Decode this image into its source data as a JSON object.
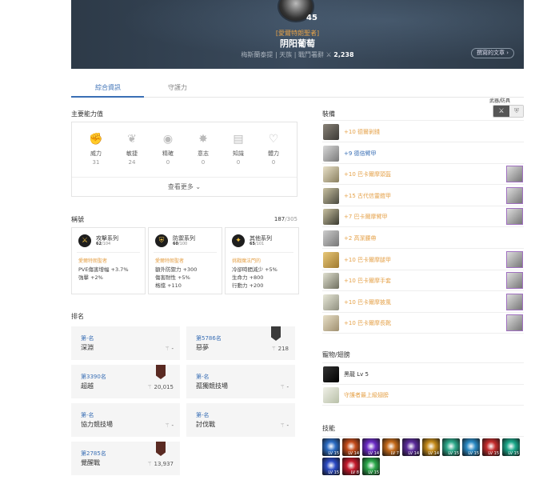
{
  "profile": {
    "level": "45",
    "guild_tag": "[愛爾特朗聖者]",
    "name": "阴阳葡萄",
    "server": "梅斯蘭泰提",
    "race": "天族",
    "score_label": "戰鬥署辭",
    "score": "2,238",
    "posts_button": "撰寫的文章 ›"
  },
  "tabs": [
    {
      "label": "綜合資訊"
    },
    {
      "label": "守護力"
    }
  ],
  "stats": {
    "heading": "主要能力值",
    "items": [
      {
        "label": "威力",
        "value": "31",
        "icon": "fist-icon"
      },
      {
        "label": "敏捷",
        "value": "24",
        "icon": "wing-icon"
      },
      {
        "label": "精確",
        "value": "0",
        "icon": "eye-icon"
      },
      {
        "label": "意志",
        "value": "0",
        "icon": "burst-icon"
      },
      {
        "label": "知識",
        "value": "0",
        "icon": "book-icon"
      },
      {
        "label": "體力",
        "value": "0",
        "icon": "heart-icon"
      }
    ],
    "more_label": "查看更多 ⌄"
  },
  "titles": {
    "heading": "稱號",
    "count": "187",
    "total": "/305",
    "cards": [
      {
        "name": "攻擊系列",
        "count": "62",
        "total": "/104",
        "desc": "愛爾特朗聖者",
        "lines": [
          "PVE傷害增幅 +3.7%",
          "強擊 +2%"
        ]
      },
      {
        "name": "防禦系列",
        "count": "60",
        "total": "/100",
        "desc": "愛爾特朗聖者",
        "lines": [
          "額外防禦力 +300",
          "傷害耐性 +5%",
          "格擋 +110"
        ]
      },
      {
        "name": "其他系列",
        "count": "65",
        "total": "/101",
        "desc": "挑戰魔法門的",
        "lines": [
          "冷卻時間減少 +5%",
          "生命力 +800",
          "行動力 +200"
        ]
      }
    ]
  },
  "rankings": {
    "heading": "排名",
    "items": [
      {
        "rank": "第-名",
        "name": "深淵",
        "score": "-"
      },
      {
        "rank": "第5786名",
        "name": "惡夢",
        "score": "218"
      },
      {
        "rank": "第3390名",
        "name": "超越",
        "score": "20,015"
      },
      {
        "rank": "第-名",
        "name": "孤獨競技場",
        "score": "-"
      },
      {
        "rank": "第-名",
        "name": "協力競技場",
        "score": "-"
      },
      {
        "rank": "第-名",
        "name": "討伐戰",
        "score": "-"
      },
      {
        "rank": "第2785名",
        "name": "覺醒戰",
        "score": "13,937"
      }
    ]
  },
  "equipment": {
    "heading": "裝備",
    "toggle_label": "武器/防具",
    "toggle_icons": [
      "sword-icon",
      "shield-icon"
    ],
    "items": [
      {
        "name": "+10 德爾剝錢",
        "color": "#e5a24a"
      },
      {
        "name": "+9 德倍臂甲",
        "color": "#3a6fb5"
      },
      {
        "name": "+10 巴卡爾摩頭盔",
        "color": "#e5a24a"
      },
      {
        "name": "+15 古代信靈鎧甲",
        "color": "#e5a24a"
      },
      {
        "name": "+7 巴卡爾摩臂甲",
        "color": "#e5a24a"
      },
      {
        "name": "+2 高潔腰帶",
        "color": "#e5a24a"
      },
      {
        "name": "+10 巴卡爾摩腿甲",
        "color": "#e5a24a"
      },
      {
        "name": "+10 巴卡爾摩手套",
        "color": "#e5a24a"
      },
      {
        "name": "+10 巴卡爾摩披風",
        "color": "#e5a24a"
      },
      {
        "name": "+10 巴卡爾摩長靴",
        "color": "#e5a24a"
      }
    ]
  },
  "pets": {
    "heading": "寵物/翅膀",
    "items": [
      {
        "name": "黑龍 Lv 5",
        "color": "#333333"
      },
      {
        "name": "守護者最上級翅膀",
        "color": "#e5a24a"
      }
    ]
  },
  "skills": {
    "heading": "技能",
    "items": [
      {
        "level": "LV 15"
      },
      {
        "level": "LV 14"
      },
      {
        "level": "LV 14"
      },
      {
        "level": "LV 7"
      },
      {
        "level": "LV 14"
      },
      {
        "level": "LV 14"
      },
      {
        "level": "LV 15"
      },
      {
        "level": "LV 15"
      },
      {
        "level": "LV 15"
      },
      {
        "level": "LV 15"
      },
      {
        "level": "LV 15"
      },
      {
        "level": "LV 8"
      },
      {
        "level": "LV 15"
      }
    ]
  }
}
